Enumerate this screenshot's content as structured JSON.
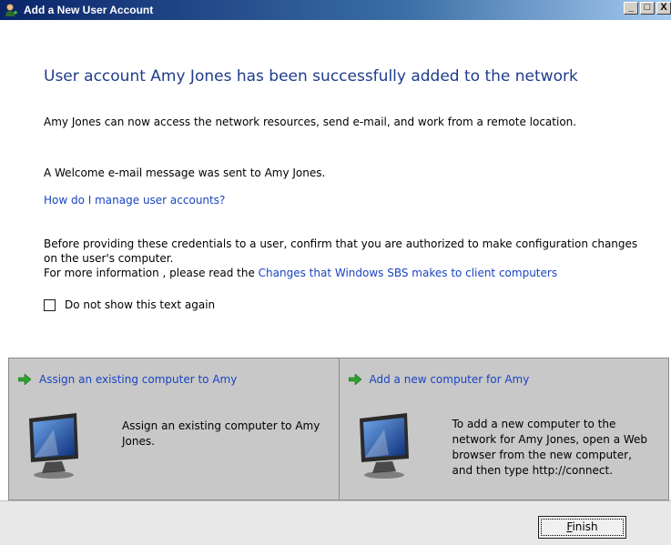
{
  "window": {
    "title": "Add a New User Account",
    "controls": {
      "minimize": "_",
      "maximize": "□",
      "close": "X"
    }
  },
  "main": {
    "heading": "User account Amy Jones has been successfully added to the network",
    "para1": "Amy Jones can now access the network resources, send e-mail, and work from a remote location.",
    "para2": "A Welcome e-mail message was sent to Amy Jones.",
    "manage_link": "How do I manage user accounts?",
    "credentials_text": "Before providing these credentials to a user, confirm that you are authorized to make configuration changes on the user's computer.",
    "more_info_prefix": "For more information , please read the ",
    "more_info_link": "Changes that Windows SBS makes to client computers",
    "checkbox_label": "Do not show this text again"
  },
  "panels": {
    "left": {
      "title": "Assign an existing computer to Amy",
      "description": "Assign an existing computer to Amy Jones."
    },
    "right": {
      "title": "Add a new computer for Amy",
      "description": "To add a new computer to the network for Amy Jones, open a Web browser from the new computer, and then type http://connect."
    }
  },
  "footer": {
    "finish_first": "F",
    "finish_rest": "inish"
  },
  "colors": {
    "link": "#1a44c2",
    "heading": "#1f3c8c",
    "panel_bg": "#c8c8c8"
  },
  "icons": {
    "title": "user-add-icon",
    "arrow": "green-arrow-icon",
    "monitor": "computer-monitor-icon"
  }
}
